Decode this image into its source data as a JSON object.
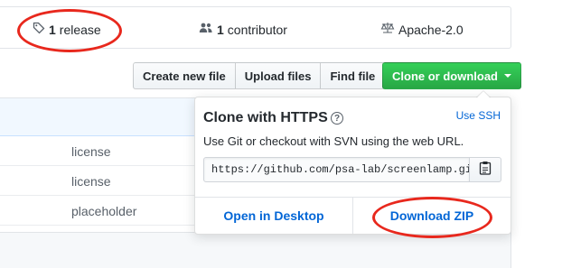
{
  "summary": {
    "release_count": "1",
    "release_label": "release",
    "contributor_count": "1",
    "contributor_label": "contributor",
    "license": "Apache-2.0"
  },
  "toolbar": {
    "create_new_file": "Create new file",
    "upload_files": "Upload files",
    "find_file": "Find file",
    "clone_or_download": "Clone or download"
  },
  "files": [
    {
      "message": "license"
    },
    {
      "message": "license"
    },
    {
      "message": "placeholder"
    }
  ],
  "clone_dropdown": {
    "title": "Clone with HTTPS",
    "help_symbol": "?",
    "use_ssh": "Use SSH",
    "description": "Use Git or checkout with SVN using the web URL.",
    "url": "https://github.com/psa-lab/screenlamp.git",
    "open_in_desktop": "Open in Desktop",
    "download_zip": "Download ZIP"
  },
  "colors": {
    "accent_green": "#28a745",
    "link_blue": "#0366d6",
    "annotation_red": "#e8281d"
  }
}
